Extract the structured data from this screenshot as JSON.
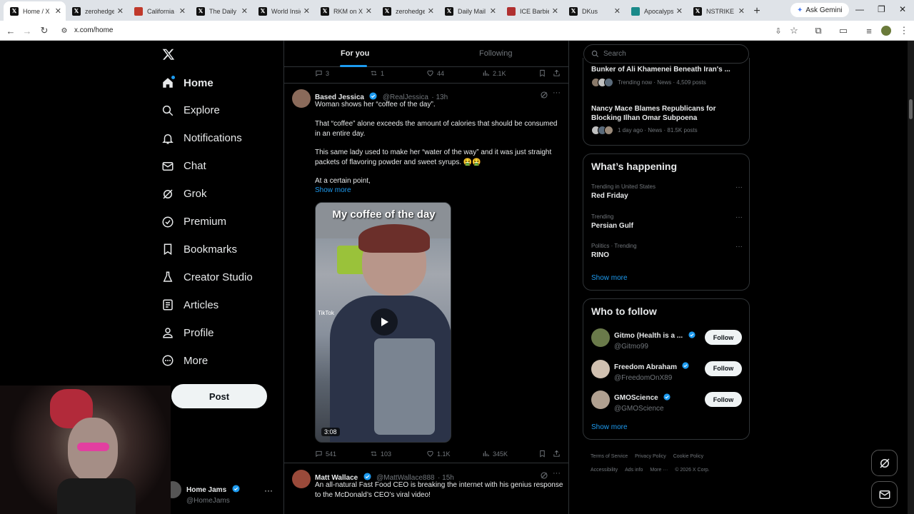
{
  "browser": {
    "tabs": [
      {
        "label": "Home / X",
        "favicon": "x"
      },
      {
        "label": "zerohedge",
        "favicon": "x"
      },
      {
        "label": "California g",
        "favicon": "red"
      },
      {
        "label": "The Daily B",
        "favicon": "x"
      },
      {
        "label": "World Insig",
        "favicon": "x"
      },
      {
        "label": "RKM on X:",
        "favicon": "x"
      },
      {
        "label": "zerohedge",
        "favicon": "x"
      },
      {
        "label": "Daily Mail",
        "favicon": "x"
      },
      {
        "label": "ICE Barbie",
        "favicon": "ice"
      },
      {
        "label": "DKus",
        "favicon": "x"
      },
      {
        "label": "Apocalypse",
        "favicon": "teal"
      },
      {
        "label": "NSTRIKE o",
        "favicon": "x"
      }
    ],
    "gemini_label": "Ask Gemini",
    "url": "x.com/home"
  },
  "nav": {
    "items": [
      {
        "label": "Home",
        "icon": "home-icon"
      },
      {
        "label": "Explore",
        "icon": "search-icon"
      },
      {
        "label": "Notifications",
        "icon": "bell-icon"
      },
      {
        "label": "Chat",
        "icon": "mail-icon"
      },
      {
        "label": "Grok",
        "icon": "grok-icon"
      },
      {
        "label": "Premium",
        "icon": "verified-icon"
      },
      {
        "label": "Bookmarks",
        "icon": "bookmark-icon"
      },
      {
        "label": "Creator Studio",
        "icon": "flask-icon"
      },
      {
        "label": "Articles",
        "icon": "article-icon"
      },
      {
        "label": "Profile",
        "icon": "person-icon"
      },
      {
        "label": "More",
        "icon": "more-circle-icon"
      }
    ],
    "post_label": "Post",
    "account": {
      "name": "Home Jams",
      "handle": "@HomeJams"
    }
  },
  "feed": {
    "tabs": {
      "for_you": "For you",
      "following": "Following"
    },
    "prev_stats": {
      "replies": "3",
      "reposts": "1",
      "likes": "44",
      "views": "2.1K"
    },
    "post1": {
      "name": "Based Jessica",
      "handle": "@RealJessica",
      "time": "· 13h",
      "line1": "Woman shows her “coffee of the day”.",
      "line2": "That “coffee” alone exceeds the amount of calories that should be consumed in an entire day.",
      "line3": "This same lady used to make her “water of the way” and it was just straight packets of flavoring powder and sweet syrups. 🤮🤮",
      "line4": "At a certain point,",
      "show_more": "Show more",
      "video_caption": "My coffee of the day",
      "video_duration": "3:08",
      "tiktok_label": "TikTok",
      "stats": {
        "replies": "541",
        "reposts": "103",
        "likes": "1.1K",
        "views": "345K"
      }
    },
    "post2": {
      "name": "Matt Wallace",
      "handle": "@MattWallace888",
      "time": "· 15h",
      "text": "An all-natural Fast Food CEO is breaking the internet with his genius response to the McDonald’s CEO’s viral video!"
    }
  },
  "right": {
    "search_placeholder": "Search",
    "news": [
      {
        "title": "Bunker of Ali Khamenei Beneath Iran's ...",
        "meta": "Trending now · News · 4,509 posts"
      },
      {
        "title": "Nancy Mace Blames Republicans for Blocking Ilhan Omar Subpoena",
        "meta": "1 day ago · News · 81.5K posts"
      }
    ],
    "happening": {
      "title": "What’s happening",
      "items": [
        {
          "context": "Trending in United States",
          "topic": "Red Friday"
        },
        {
          "context": "Trending",
          "topic": "Persian Gulf"
        },
        {
          "context": "Politics · Trending",
          "topic": "RINO"
        }
      ],
      "show_more": "Show more"
    },
    "who_to_follow": {
      "title": "Who to follow",
      "users": [
        {
          "name": "Gitmo (Health is a ...",
          "handle": "@Gitmo99",
          "button": "Follow"
        },
        {
          "name": "Freedom Abraham",
          "handle": "@FreedomOnX89",
          "button": "Follow"
        },
        {
          "name": "GMOScience",
          "handle": "@GMOScience",
          "button": "Follow"
        }
      ],
      "show_more": "Show more"
    },
    "footer": {
      "links": [
        "Terms of Service",
        "Privacy Policy",
        "Cookie Policy",
        "Accessibility",
        "Ads info",
        "More ···"
      ],
      "copyright": "© 2026 X Corp."
    }
  }
}
